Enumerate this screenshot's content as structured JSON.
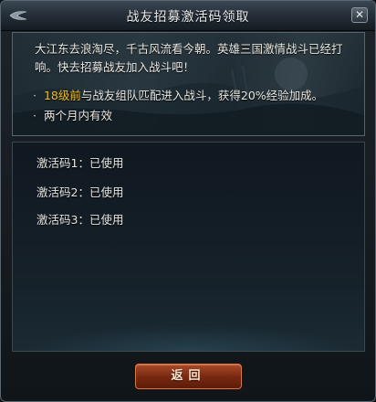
{
  "window": {
    "title": "战友招募激活码领取",
    "close_glyph": "✕"
  },
  "info": {
    "intro": "大江东去浪淘尽，千古风流看今朝。英雄三国激情战斗已经打响。快去招募战友加入战斗吧！",
    "bullets": [
      {
        "dot": "·",
        "highlight": "18级前",
        "text": "与战友组队匹配进入战斗，获得20%经验加成。"
      },
      {
        "dot": "·",
        "highlight": "",
        "text": "两个月内有效"
      }
    ],
    "highlight_color": "#f4c01c"
  },
  "codes": [
    {
      "label": "激活码1：已使用"
    },
    {
      "label": "激活码2：已使用"
    },
    {
      "label": "激活码3：已使用"
    }
  ],
  "footer": {
    "back_label": "返回"
  },
  "icons": {
    "title_ornament": "wing-ornament-icon",
    "close": "close-icon"
  },
  "colors": {
    "button_red": "#7a2a12",
    "text": "#e8e8e2"
  }
}
